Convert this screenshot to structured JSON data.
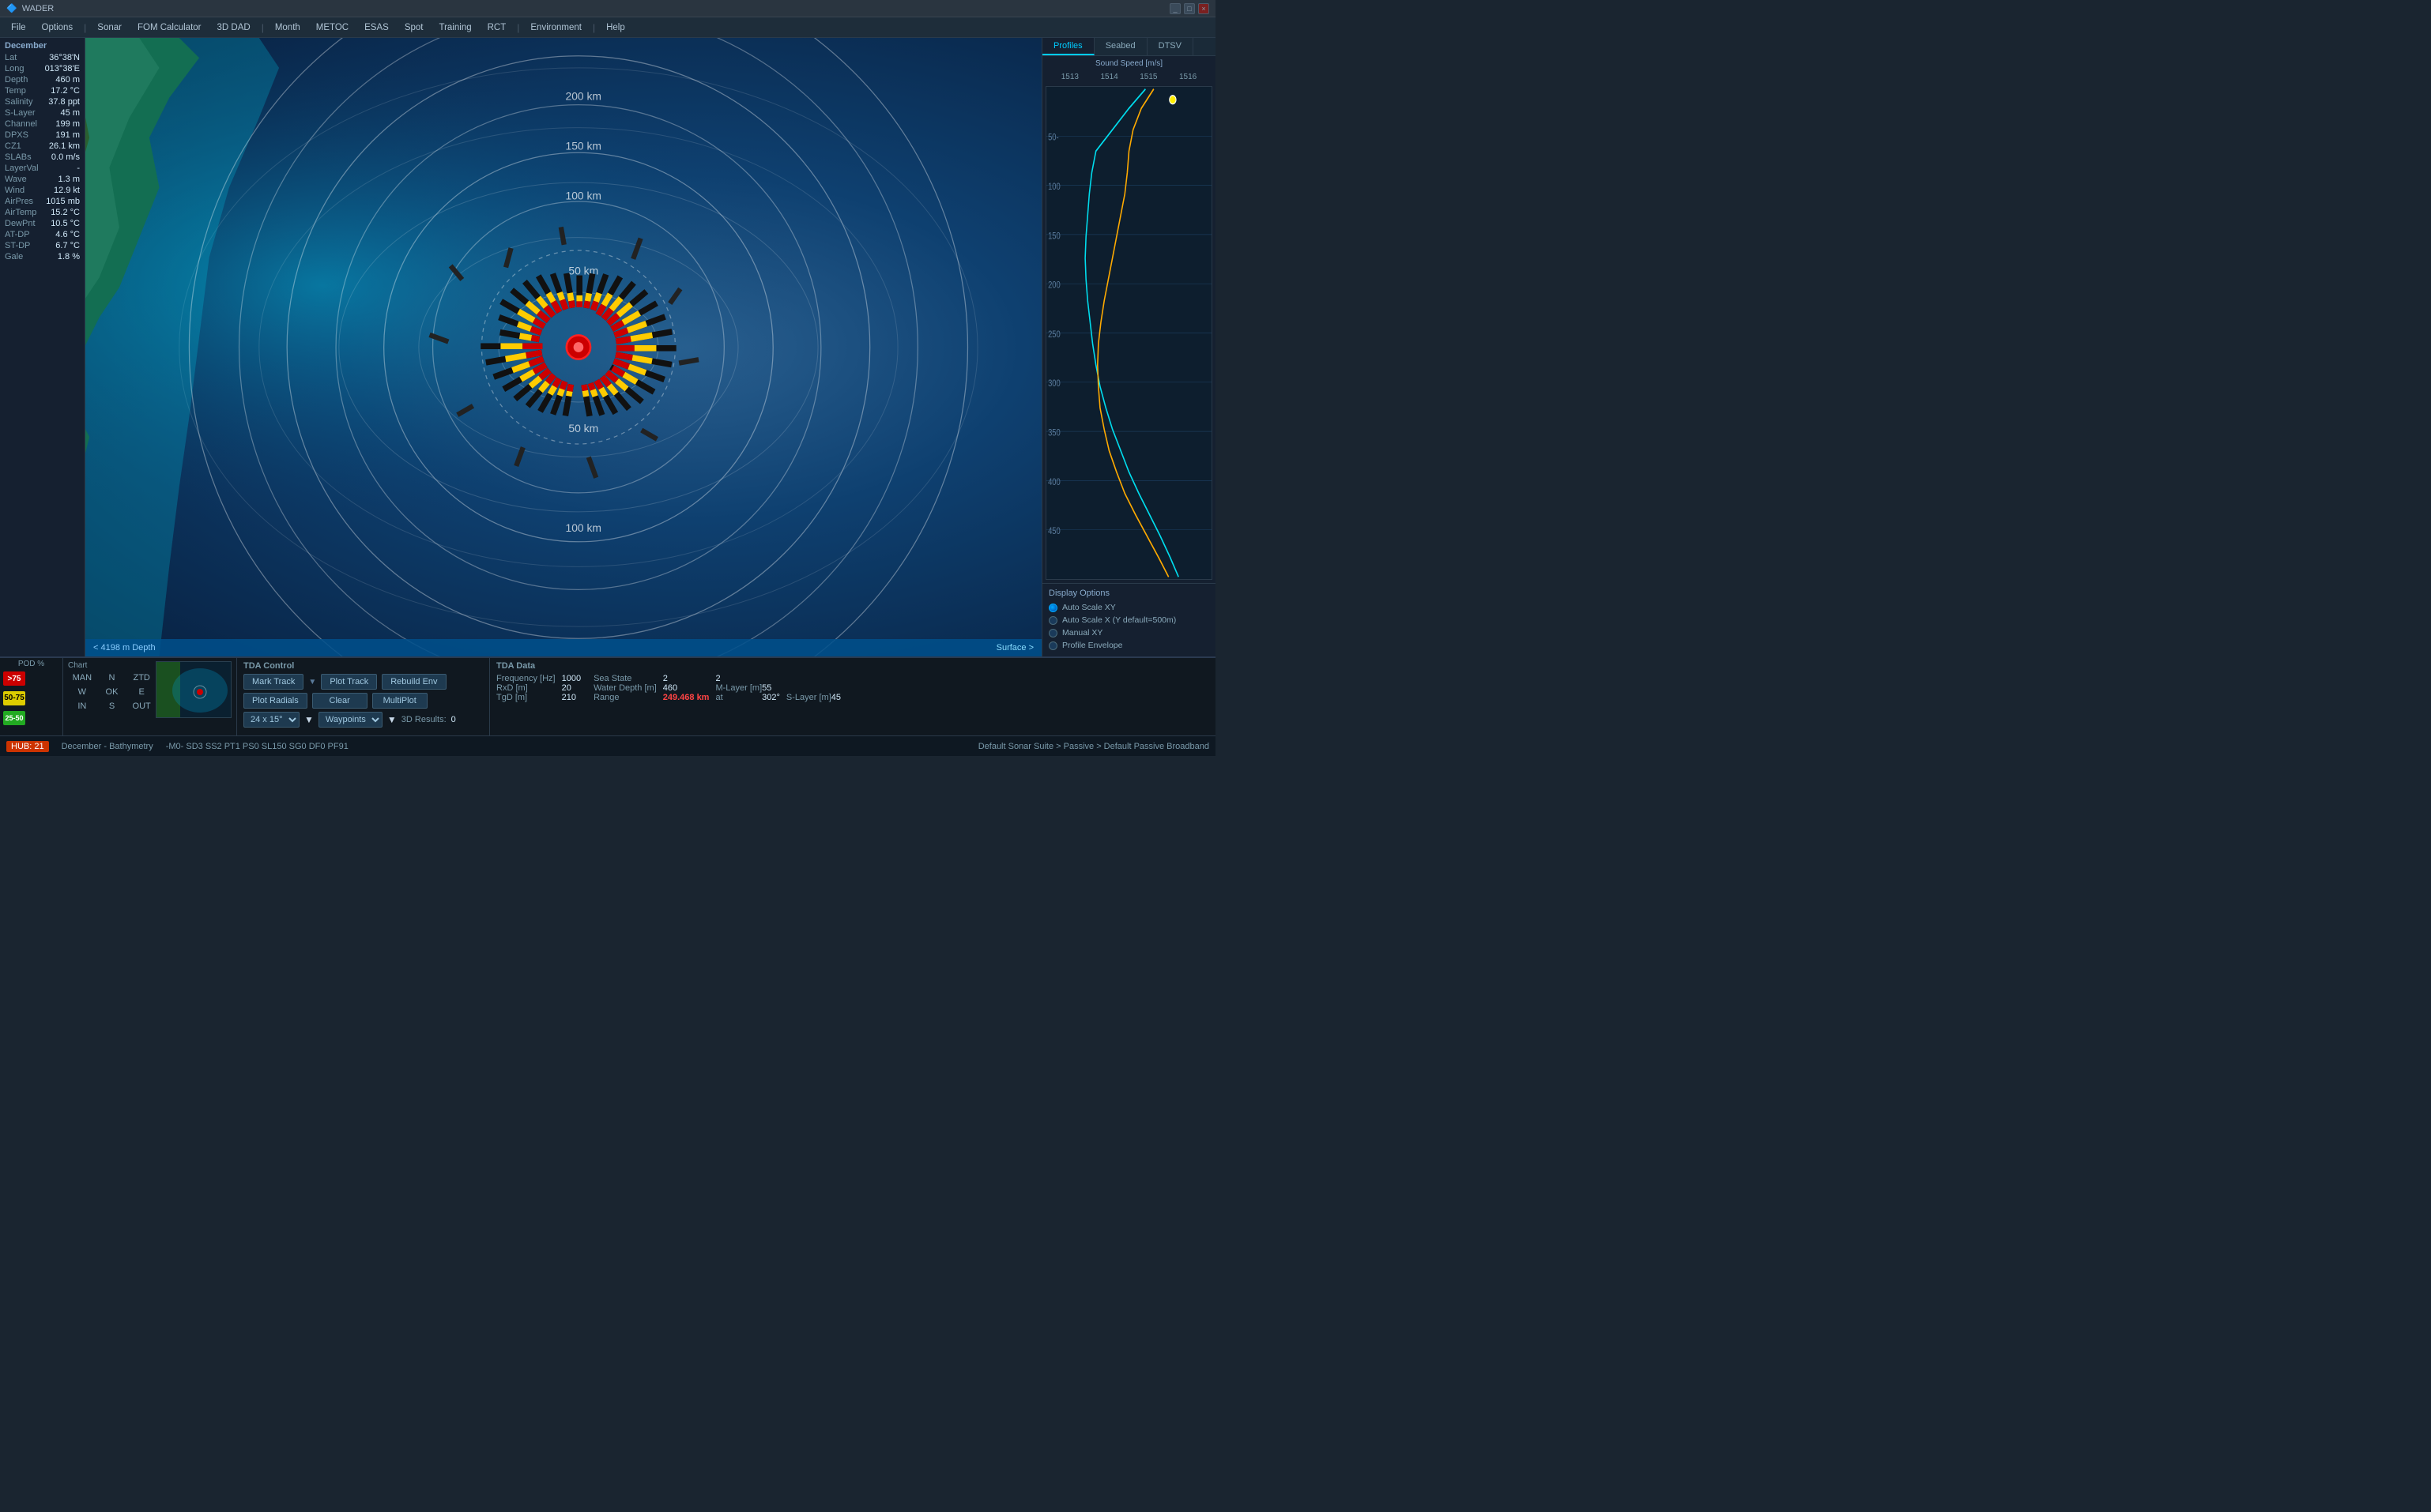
{
  "app": {
    "title": "WADER"
  },
  "titlebar": {
    "title": "WADER",
    "minimize": "_",
    "maximize": "□",
    "close": "×"
  },
  "menubar": {
    "items": [
      {
        "label": "File",
        "id": "file"
      },
      {
        "label": "Options",
        "id": "options"
      },
      {
        "label": "Sonar",
        "id": "sonar"
      },
      {
        "label": "FOM Calculator",
        "id": "fom"
      },
      {
        "label": "3D DAD",
        "id": "3ddad"
      },
      {
        "label": "Month",
        "id": "month"
      },
      {
        "label": "METOC",
        "id": "metoc"
      },
      {
        "label": "ESAS",
        "id": "esas"
      },
      {
        "label": "Spot",
        "id": "spot"
      },
      {
        "label": "Training",
        "id": "training"
      },
      {
        "label": "RCT",
        "id": "rct"
      },
      {
        "label": "Environment",
        "id": "environment"
      },
      {
        "label": "Help",
        "id": "help"
      }
    ]
  },
  "left_panel": {
    "section": "December",
    "fields": [
      {
        "label": "Lat",
        "value": "36°38'N"
      },
      {
        "label": "Long",
        "value": "013°38'E"
      },
      {
        "label": "Depth",
        "value": "460 m"
      },
      {
        "label": "Temp",
        "value": "17.2 °C"
      },
      {
        "label": "Salinity",
        "value": "37.8 ppt"
      },
      {
        "label": "S-Layer",
        "value": "45 m"
      },
      {
        "label": "Channel",
        "value": "199 m"
      },
      {
        "label": "DPXS",
        "value": "191 m"
      },
      {
        "label": "CZ1",
        "value": "26.1 km"
      },
      {
        "label": "SLABs",
        "value": "0.0 m/s"
      },
      {
        "label": "LayerVal",
        "value": "-"
      },
      {
        "label": "Wave",
        "value": "1.3 m"
      },
      {
        "label": "Wind",
        "value": "12.9 kt"
      },
      {
        "label": "AirPres",
        "value": "1015 mb"
      },
      {
        "label": "AirTemp",
        "value": "15.2 °C"
      },
      {
        "label": "DewPnt",
        "value": "10.5 °C"
      },
      {
        "label": "AT-DP",
        "value": "4.6 °C"
      },
      {
        "label": "ST-DP",
        "value": "6.7 °C"
      },
      {
        "label": "Gale",
        "value": "1.8 %"
      }
    ]
  },
  "map": {
    "depth_status": "< 4198 m Depth",
    "surface_label": "Surface >",
    "range_labels": [
      "200 km",
      "150 km",
      "100 km",
      "50 km",
      "50 km",
      "100 km"
    ]
  },
  "profiles": {
    "tabs": [
      "Profiles",
      "Seabed",
      "DTSV"
    ],
    "active_tab": "Profiles",
    "chart_title": "Sound Speed [m/s]",
    "scale_values": [
      "1513",
      "1514",
      "1515",
      "1516"
    ],
    "depth_labels": [
      "50-",
      "100",
      "150",
      "200",
      "250",
      "300",
      "350",
      "400",
      "450"
    ],
    "display_options_title": "Display Options",
    "options": [
      {
        "label": "Auto Scale XY",
        "selected": true
      },
      {
        "label": "Auto Scale X (Y default=500m)",
        "selected": false
      },
      {
        "label": "Manual XY",
        "selected": false
      },
      {
        "label": "Profile Envelope",
        "selected": false
      }
    ]
  },
  "pod": {
    "title": "POD %",
    "rows": [
      {
        "color": "red",
        "label": ">75"
      },
      {
        "color": "yellow",
        "label": "50-75"
      },
      {
        "color": "green",
        "label": "25-50"
      }
    ]
  },
  "chart_section": {
    "title": "Chart",
    "rows": [
      [
        "MAN",
        "N",
        "ZTD"
      ],
      [
        "W",
        "OK",
        "E"
      ],
      [
        "IN",
        "S",
        "OUT"
      ]
    ]
  },
  "tda_control": {
    "title": "TDA Control",
    "buttons": {
      "mark_track": "Mark Track",
      "plot_track": "Plot Track",
      "rebuild_env": "Rebuild Env",
      "plot_radials": "Plot Radials",
      "clear": "Clear",
      "multiplot": "MultiPlot"
    },
    "row3": {
      "size_select": "24 x 15°",
      "waypoints": "Waypoints",
      "results_label": "3D Results:",
      "results_value": "0"
    }
  },
  "tda_data": {
    "title": "TDA Data",
    "fields": [
      {
        "label": "Frequency [Hz]",
        "value": "1000"
      },
      {
        "label": "Sea State",
        "value": "2"
      },
      {
        "value2": "2"
      },
      {
        "label": "RxD [m]",
        "value": "20"
      },
      {
        "label": "Water Depth [m]",
        "value": "460"
      },
      {
        "label": "M-Layer [m]",
        "value": "55"
      },
      {
        "label": "TgD [m]",
        "value": "210"
      },
      {
        "label": "Range",
        "value": "249.468 km",
        "highlight": true
      },
      {
        "label": "at",
        "value": "302°"
      },
      {
        "label": "S-Layer [m]",
        "value": "45"
      }
    ]
  },
  "statusbar": {
    "hub_label": "HUB: 21",
    "month": "December - Bathymetry",
    "mode_string": "-M0-  SD3  SS2  PT1  PS0  SL150  SG0  DF0  PF91",
    "sonar_string": "Default Sonar Suite > Passive > Default Passive Broadband"
  }
}
